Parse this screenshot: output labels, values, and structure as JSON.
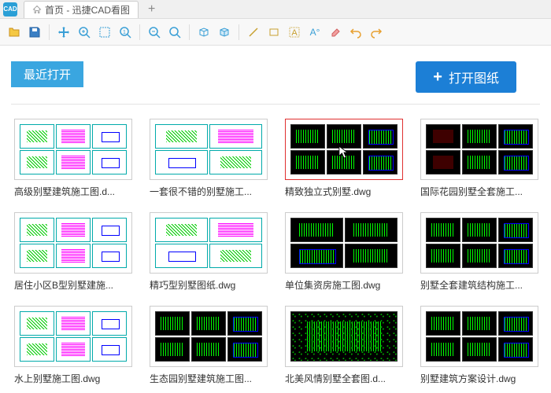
{
  "titlebar": {
    "tab_label": "首页 - 迅捷CAD看图"
  },
  "toolbar": {
    "icons": [
      "folder",
      "save",
      "move",
      "zoom-in",
      "select",
      "reset",
      "zoom-out",
      "zoom-fit",
      "cube",
      "cube3d",
      "line",
      "rect",
      "text",
      "text-a",
      "eraser",
      "undo",
      "redo"
    ]
  },
  "home": {
    "recent_label": "最近打开",
    "open_button": "打开图纸"
  },
  "files": [
    {
      "name": "高级别墅建筑施工图.d...",
      "style": "grid6-light",
      "selected": false
    },
    {
      "name": "一套很不错的别墅施工...",
      "style": "grid4-light",
      "selected": false
    },
    {
      "name": "精致独立式别墅.dwg",
      "style": "grid6-dark",
      "selected": true
    },
    {
      "name": "国际花园别墅全套施工...",
      "style": "grid6-dark-red",
      "selected": false
    },
    {
      "name": "居住小区B型别墅建施...",
      "style": "grid6-light",
      "selected": false
    },
    {
      "name": "精巧型别墅图纸.dwg",
      "style": "grid4-light",
      "selected": false
    },
    {
      "name": "单位集资房施工图.dwg",
      "style": "grid4-dark",
      "selected": false
    },
    {
      "name": "别墅全套建筑结构施工...",
      "style": "grid6-dark",
      "selected": false
    },
    {
      "name": "水上别墅施工图.dwg",
      "style": "grid6-light",
      "selected": false
    },
    {
      "name": "生态园别墅建筑施工图...",
      "style": "grid6-dark",
      "selected": false
    },
    {
      "name": "北美风情别墅全套图.d...",
      "style": "full-dark",
      "selected": false
    },
    {
      "name": "别墅建筑方案设计.dwg",
      "style": "grid6-dark",
      "selected": false
    }
  ]
}
